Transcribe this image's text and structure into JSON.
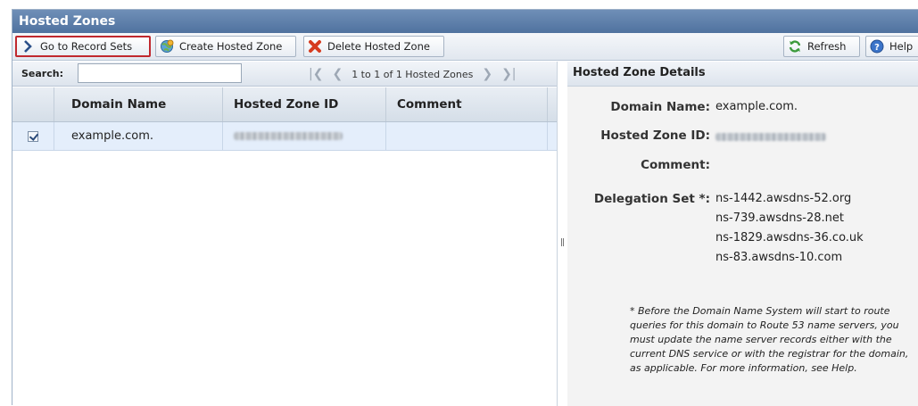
{
  "panel": {
    "title": "Hosted Zones"
  },
  "toolbar": {
    "go_to_record_sets": "Go to Record Sets",
    "create_hosted_zone": "Create Hosted Zone",
    "delete_hosted_zone": "Delete Hosted Zone",
    "refresh": "Refresh",
    "help": "Help"
  },
  "search": {
    "label": "Search:",
    "value": ""
  },
  "pager": {
    "text": "1 to 1 of 1 Hosted Zones"
  },
  "table": {
    "columns": [
      "Domain Name",
      "Hosted Zone ID",
      "Comment"
    ],
    "rows": [
      {
        "checked": true,
        "domain": "example.com.",
        "zone_id": "",
        "comment": ""
      }
    ]
  },
  "details": {
    "title": "Hosted Zone Details",
    "domain_label": "Domain Name:",
    "domain_value": "example.com.",
    "zone_id_label": "Hosted Zone ID:",
    "comment_label": "Comment:",
    "comment_value": "",
    "delegation_label": "Delegation Set *:",
    "name_servers": [
      "ns-1442.awsdns-52.org",
      "ns-739.awsdns-28.net",
      "ns-1829.awsdns-36.co.uk",
      "ns-83.awsdns-10.com"
    ],
    "note": "* Before the Domain Name System will start to route queries for this domain to Route 53 name servers, you must update the name server records either with the current DNS service or with the registrar for the domain, as applicable. For more information, see Help."
  },
  "colors": {
    "title_bar": "#5b7cab",
    "selected_row": "#e4eefb",
    "highlight_border": "#c0282e"
  }
}
